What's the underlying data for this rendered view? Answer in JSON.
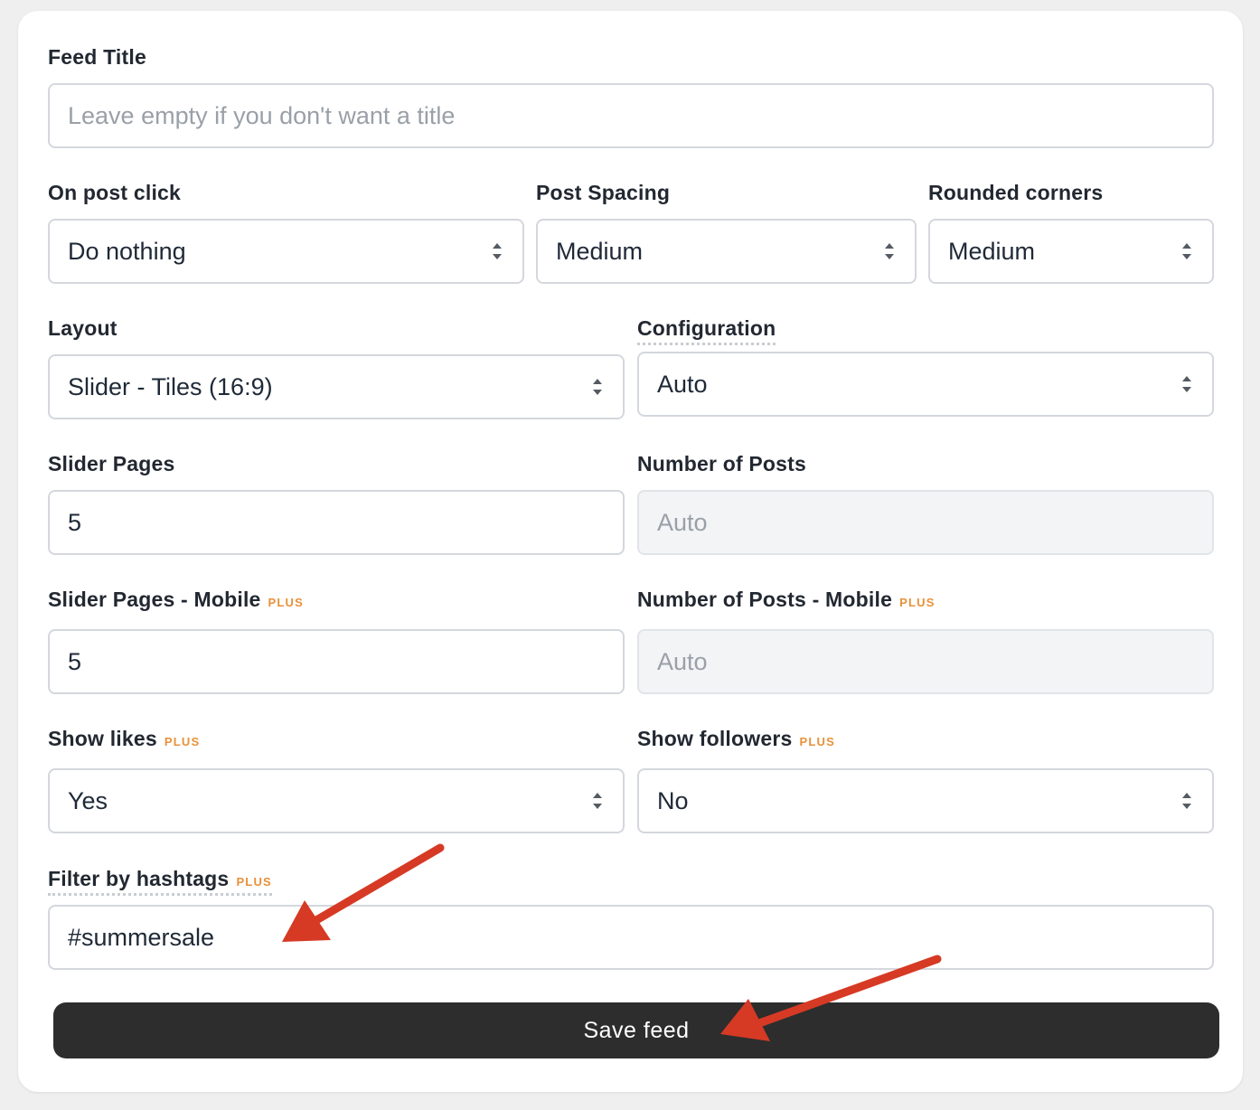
{
  "feed_title": {
    "label": "Feed Title",
    "placeholder": "Leave empty if you don't want a title"
  },
  "on_post_click": {
    "label": "On post click",
    "value": "Do nothing"
  },
  "post_spacing": {
    "label": "Post Spacing",
    "value": "Medium"
  },
  "rounded_corners": {
    "label": "Rounded corners",
    "value": "Medium"
  },
  "layout": {
    "label": "Layout",
    "value": "Slider - Tiles (16:9)"
  },
  "configuration": {
    "label": "Configuration",
    "value": "Auto"
  },
  "slider_pages": {
    "label": "Slider Pages",
    "value": "5"
  },
  "number_of_posts": {
    "label": "Number of Posts",
    "value": "Auto"
  },
  "slider_pages_mobile": {
    "label": "Slider Pages - Mobile",
    "badge": "PLUS",
    "value": "5"
  },
  "number_of_posts_mobile": {
    "label": "Number of Posts - Mobile",
    "badge": "PLUS",
    "value": "Auto"
  },
  "show_likes": {
    "label": "Show likes",
    "badge": "PLUS",
    "value": "Yes"
  },
  "show_followers": {
    "label": "Show followers",
    "badge": "PLUS",
    "value": "No"
  },
  "filter_hashtags": {
    "label": "Filter by hashtags",
    "badge": "PLUS",
    "value": "#summersale"
  },
  "save_button": {
    "label": "Save feed"
  },
  "colors": {
    "accent_badge": "#e8913a",
    "annotation_arrow": "#d63a24",
    "button_bg": "#2d2d2d"
  }
}
